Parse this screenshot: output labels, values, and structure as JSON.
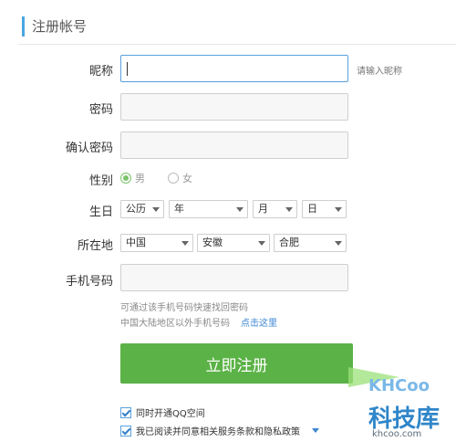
{
  "header": {
    "title": "注册帐号"
  },
  "form": {
    "nickname": {
      "label": "昵称",
      "value": "",
      "hint": "请输入昵称"
    },
    "password": {
      "label": "密码",
      "value": ""
    },
    "confirm_password": {
      "label": "确认密码",
      "value": ""
    },
    "gender": {
      "label": "性别",
      "options": [
        "男",
        "女"
      ],
      "selected": "男"
    },
    "birthday": {
      "label": "生日",
      "calendar": "公历",
      "year": "年",
      "month": "月",
      "day": "日"
    },
    "location": {
      "label": "所在地",
      "country": "中国",
      "province": "安徽",
      "city": "合肥"
    },
    "phone": {
      "label": "手机号码",
      "value": "",
      "tip_line1": "可通过该手机号码快速找回密码",
      "tip_line2": "中国大陆地区以外手机号码",
      "tip_link": "点击这里"
    }
  },
  "register_button": {
    "label": "立即注册"
  },
  "options": [
    {
      "label": "同时开通QQ空间",
      "checked": true
    },
    {
      "label": "我已阅读并同意相关服务条款和隐私政策",
      "checked": true
    }
  ],
  "watermark": {
    "logo": "KHCoo",
    "cn": "科技库",
    "url": "khcoo.com"
  },
  "colors": {
    "accent": "#4aa7e0",
    "button": "#5bb246",
    "link": "#3b86d1"
  }
}
